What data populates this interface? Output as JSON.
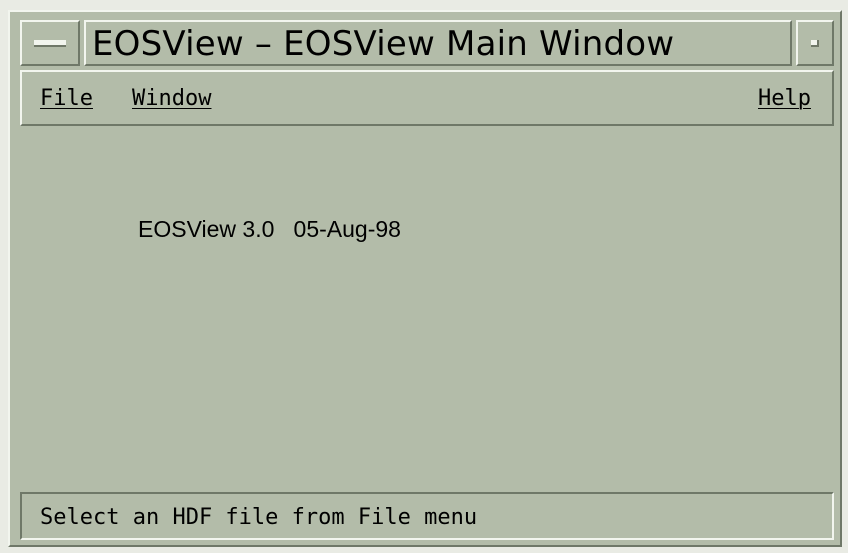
{
  "window": {
    "title": "EOSView – EOSView Main Window"
  },
  "menubar": {
    "file_label": "File",
    "window_label": "Window",
    "help_label": "Help"
  },
  "main": {
    "version_text": "EOSView 3.0   05-Aug-98"
  },
  "statusbar": {
    "message": "Select an HDF file from File menu"
  },
  "icons": {
    "window_menu": "window-menu-icon",
    "minimize": "minimize-icon"
  },
  "colors": {
    "window_background": "#b3bca9",
    "highlight": "#f2f5ee",
    "shadow": "#6f7868",
    "text": "#000000"
  }
}
